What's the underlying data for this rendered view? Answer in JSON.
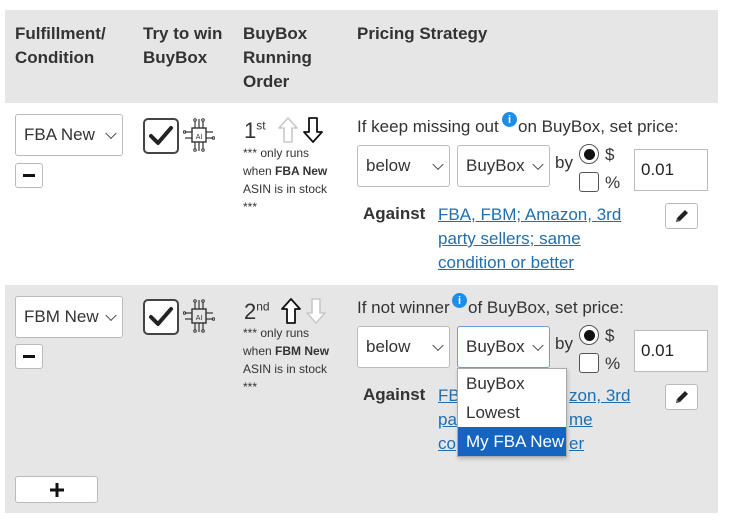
{
  "header": {
    "fulfillment": "Fulfillment/ Condition",
    "try_to_win": "Try to win BuyBox",
    "running_order": "BuyBox Running Order",
    "pricing_strategy": "Pricing Strategy"
  },
  "rows": [
    {
      "fulfillment_value": "FBA New",
      "order_num": "1",
      "order_suffix": "st",
      "note_pre": "*** only runs when ",
      "note_bold": "FBA New",
      "note_post": " ASIN is in stock ***",
      "strategy_pre": "If keep missing out",
      "strategy_post": " on BuyBox, set price:",
      "direction": "below",
      "reference": "BuyBox",
      "by": "by",
      "unit_dollar": "$",
      "unit_percent": "%",
      "amount": "0.01",
      "against_label": "Against",
      "against_link": "FBA, FBM; Amazon, 3rd party sellers; same condition or better"
    },
    {
      "fulfillment_value": "FBM New",
      "order_num": "2",
      "order_suffix": "nd",
      "note_pre": "*** only runs when ",
      "note_bold": "FBM New",
      "note_post": " ASIN is in stock ***",
      "strategy_pre": "If not winner",
      "strategy_post": " of BuyBox, set price:",
      "direction": "below",
      "reference": "BuyBox",
      "by": "by",
      "unit_dollar": "$",
      "unit_percent": "%",
      "amount": "0.01",
      "against_label": "Against",
      "against_link_visible": [
        "FB",
        "zon, 3rd",
        "pa",
        "me",
        "co",
        "er"
      ]
    }
  ],
  "dropdown_options": [
    "BuyBox",
    "Lowest",
    "My FBA New"
  ],
  "dropdown_selected": "My FBA New",
  "colors": {
    "header_bg": "#e6e6e6",
    "link": "#1e6fb0",
    "info": "#1a8ee8",
    "highlight": "#1565c0"
  },
  "icons": [
    "check-icon",
    "ai-chip-icon",
    "arrow-up-icon",
    "arrow-down-icon",
    "info-icon",
    "pencil-icon",
    "minus-icon",
    "plus-icon",
    "chevron-down-icon"
  ]
}
